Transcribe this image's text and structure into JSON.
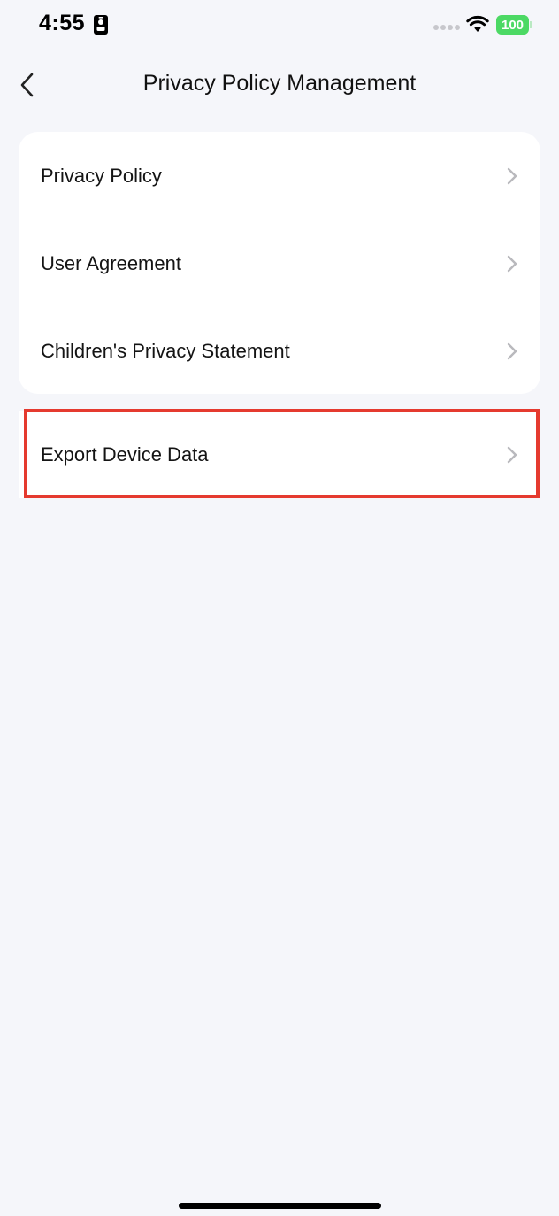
{
  "status_bar": {
    "time": "4:55",
    "battery": "100"
  },
  "header": {
    "title": "Privacy Policy Management"
  },
  "menu": {
    "items": [
      {
        "label": "Privacy Policy"
      },
      {
        "label": "User Agreement"
      },
      {
        "label": "Children's Privacy Statement"
      }
    ]
  },
  "export": {
    "label": "Export Device Data"
  },
  "colors": {
    "background": "#f5f6fa",
    "card": "#ffffff",
    "battery": "#4cd964",
    "highlight": "#e53a2f",
    "chevron": "#b9b9bd"
  },
  "icons": {
    "back": "chevron-left-icon",
    "row": "chevron-right-icon",
    "status_id": "id-card-icon",
    "wifi": "wifi-icon"
  }
}
